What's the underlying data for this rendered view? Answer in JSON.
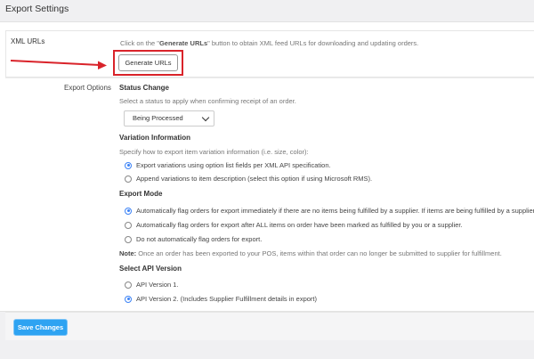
{
  "header": {
    "title": "Export Settings"
  },
  "xml_urls": {
    "label": "XML URLs",
    "hint_prefix": "Click on the \"",
    "hint_bold": "Generate URLs",
    "hint_suffix": "\" button to obtain XML feed URLs for downloading and updating orders.",
    "button_label": "Generate URLs"
  },
  "export_options": {
    "label": "Export Options",
    "status_change": {
      "heading": "Status Change",
      "description": "Select a status to apply when confirming receipt of an order.",
      "selected": "Being Processed"
    },
    "variation": {
      "heading": "Variation Information",
      "description": "Specify how to export item variation information (i.e. size, color):",
      "options": [
        "Export variations using option list fields per XML API specification.",
        "Append variations to item description (select this option if using Microsoft RMS)."
      ],
      "selected_index": 0
    },
    "export_mode": {
      "heading": "Export Mode",
      "options": [
        "Automatically flag orders for export immediately if there are no items being fulfilled by a supplier. If items are being fulfilled by a supplier, fla",
        "Automatically flag orders for export after ALL items on order have been marked as fulfilled by you or a supplier.",
        "Do not automatically flag orders for export."
      ],
      "selected_index": 0,
      "note_label": "Note:",
      "note_text": " Once an order has been exported to your POS, items within that order can no longer be submitted to supplier for fulfillment."
    },
    "api_version": {
      "heading": "Select API Version",
      "options": [
        "API Version 1.",
        "API Version 2. (Includes Supplier Fulfillment details in export)"
      ],
      "selected_index": 1
    }
  },
  "footer": {
    "save_label": "Save Changes"
  },
  "colors": {
    "accent": "#2ea3f2",
    "radio_selected": "#3b82f6",
    "annotation": "#d9232a"
  }
}
